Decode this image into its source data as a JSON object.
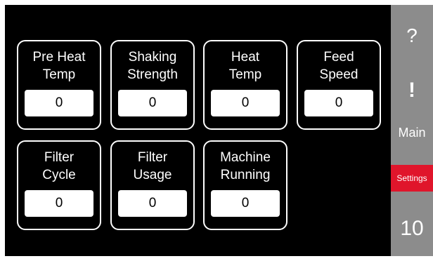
{
  "tiles": [
    {
      "label": "Pre Heat\nTemp",
      "value": "0"
    },
    {
      "label": "Shaking\nStrength",
      "value": "0"
    },
    {
      "label": "Heat\nTemp",
      "value": "0"
    },
    {
      "label": "Feed\nSpeed",
      "value": "0"
    },
    {
      "label": "Filter\nCycle",
      "value": "0"
    },
    {
      "label": "Filter\nUsage",
      "value": "0"
    },
    {
      "label": "Machine\nRunning",
      "value": "0"
    }
  ],
  "sidebar": {
    "help_label": "?",
    "alert_label": "!",
    "main_label": "Main",
    "settings_label": "Settings",
    "page_number": "10"
  },
  "colors": {
    "panel_background": "#000000",
    "sidebar_background": "#8c8c8c",
    "settings_active": "#e0152b",
    "tile_border": "#ffffff"
  }
}
